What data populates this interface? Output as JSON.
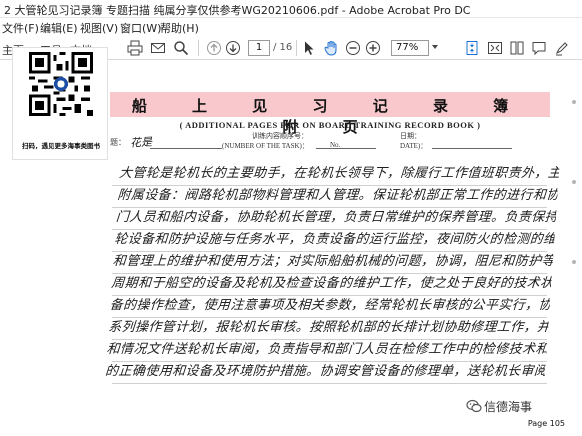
{
  "window": {
    "title": "2 大管轮见习记录簿  专题扫描  纯属分享仅供参考WG20210606.pdf - Adobe Acrobat Pro DC"
  },
  "menu": {
    "items": [
      "文件(F)",
      "编辑(E)",
      "视图(V)",
      "窗口(W)",
      "帮助(H)"
    ]
  },
  "toolbar": {
    "home": "主页",
    "tools": "工具",
    "document": "文档",
    "page_current": "1",
    "page_total": "/ 16",
    "zoom": "77%"
  },
  "qr": {
    "caption": "扫码，遇见更多海事类图书"
  },
  "document": {
    "header_title": "船 上 见 习 记 录 簿 附 页",
    "header_subtitle": "( ADDITIONAL PAGES FOR ON BOARD TRAINING RECORD BOOK )",
    "task_label_cn": "训练内容顺序号：",
    "task_label_en": "(NUMBER OF THE TASK)：",
    "task_no": "No.",
    "date_label_cn": "日期：",
    "date_label_en": "DATE)：",
    "left_mark": "题：",
    "signature": "花是",
    "handwriting_lines": [
      "大管轮是轮机长的主要助手，在轮机长领导下，除履行工作值班职责外，主要负责主机及",
      "附属设备：阀路轮机部物料管理和人管理。保证轮机部正常工作的进行和协调，督促轮机",
      "门人员和船内设备，协助轮机长管理，负责日常维护的保养管理。负责保持本轮机部管理，协调和",
      "轮设备和防护设施与任务水平，负责设备的运行监控，夜间防火的检测的维护和讨论，负责指导前人员安排",
      "和管理上的维护和使用方法；对实际船舶机械的问题，协调，阻尼和防护等工作，负责船舶设备保持",
      "周期和于船空的设备及轮机及检查设备的维护工作，使之处于良好的技术状态，负责船舶的备设",
      "备的操作检查，使用注意事项及相关参数，经常轮机长审核的公平实行，协调文件管设备的安全",
      "系列操作管计划，报轮机长审核。按照轮机部的长排计划协助修理工作，并记录维修数据",
      "和情况文件送轮机长审阅，负责指导和部门人员在检修工作中的检修技术和工具的使用设备，执监",
      "的正确使用和设备及环境防护措施。协调安管设备的修理单，送轮机长审阅。"
    ],
    "page_number": "Page 105"
  },
  "watermark": {
    "text": "信德海事"
  }
}
